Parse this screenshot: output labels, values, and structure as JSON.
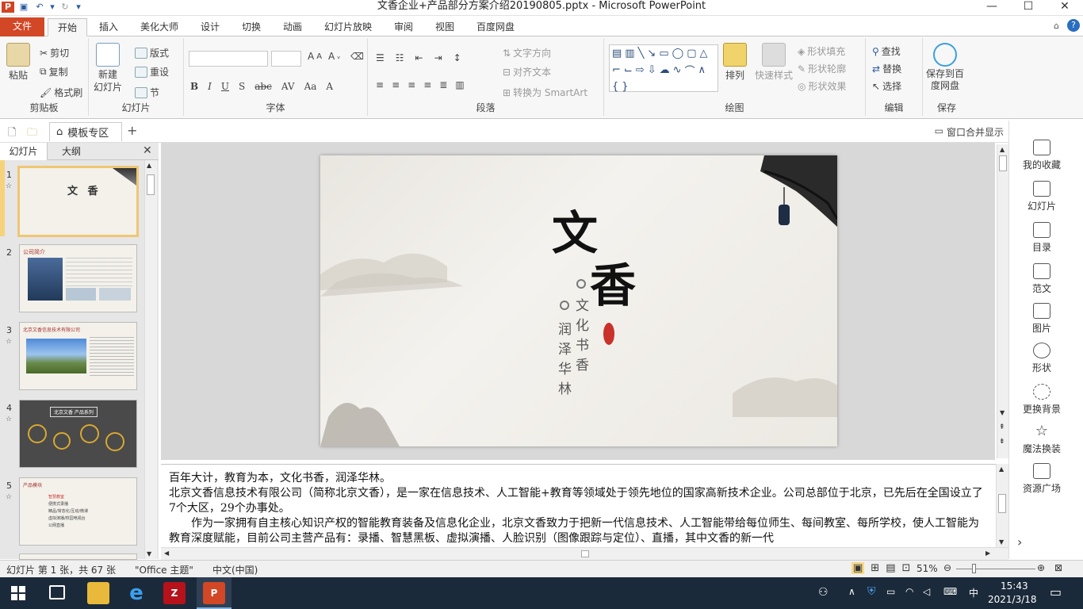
{
  "window": {
    "title": "文香企业+产品部分方案介绍20190805.pptx - Microsoft PowerPoint"
  },
  "ribbon_tabs": [
    "文件",
    "开始",
    "插入",
    "美化大师",
    "设计",
    "切换",
    "动画",
    "幻灯片放映",
    "审阅",
    "视图",
    "百度网盘"
  ],
  "ribbon": {
    "clipboard": {
      "paste": "粘贴",
      "cut": "剪切",
      "copy": "复制",
      "format_painter": "格式刷",
      "label": "剪贴板"
    },
    "slides": {
      "new_slide_1": "新建",
      "new_slide_2": "幻灯片",
      "layout": "版式",
      "reset": "重设",
      "section": "节",
      "label": "幻灯片"
    },
    "font": {
      "label": "字体"
    },
    "paragraph": {
      "text_direction": "文字方向",
      "align_text": "对齐文本",
      "smartart": "转换为 SmartArt",
      "label": "段落"
    },
    "drawing": {
      "arrange": "排列",
      "quick_styles": "快速样式",
      "shape_fill": "形状填充",
      "shape_outline": "形状轮廓",
      "shape_effects": "形状效果",
      "label": "绘图"
    },
    "editing": {
      "find": "查找",
      "replace": "替换",
      "select": "选择",
      "label": "编辑"
    },
    "save": {
      "baidu_1": "保存到百",
      "baidu_2": "度网盘",
      "label": "保存"
    }
  },
  "secondary_bar": {
    "template_tab": "模板专区",
    "merge_windows": "窗口合并显示"
  },
  "side_tabs": {
    "slides": "幻灯片",
    "outline": "大纲"
  },
  "thumbnails": [
    {
      "num": "1",
      "title": "文 香"
    },
    {
      "num": "2",
      "title": "公司简介"
    },
    {
      "num": "3",
      "title": "北京文香信息技术有限公司"
    },
    {
      "num": "4",
      "title": "北京文香 产品系列"
    },
    {
      "num": "5",
      "title": "产品模块"
    }
  ],
  "thumb5_items": [
    "智慧教室",
    "便携式录播",
    "精品/常态化/互动/微课",
    "虚拟演播/校园电视台",
    "公网直播"
  ],
  "slide": {
    "big_char_1": "文",
    "big_char_2": "香",
    "col_1": "文化书香",
    "col_2": "润泽华林"
  },
  "notes": {
    "line1": "百年大计，教育为本，文化书香，润泽华林。",
    "line2": "北京文香信息技术有限公司（简称北京文香），是一家在信息技术、人工智能+教育等领域处于领先地位的国家高新技术企业。公司总部位于北京，已先后在全国设立了7个大区，29个办事处。",
    "line3": "　　作为一家拥有自主核心知识产权的智能教育装备及信息化企业，北京文香致力于把新一代信息技术、人工智能带给每位师生、每间教室、每所学校，使人工智能为教育深度赋能，目前公司主营产品有：录播、智慧黑板、虚拟演播、人脸识别（图像跟踪与定位）、直播，其中文香的新一代"
  },
  "right_panel": [
    "我的收藏",
    "幻灯片",
    "目录",
    "范文",
    "图片",
    "形状",
    "更换背景",
    "魔法换装",
    "资源广场"
  ],
  "status": {
    "slide_info": "幻灯片 第 1 张，共 67 张",
    "theme": "\"Office 主题\"",
    "language": "中文(中国)",
    "zoom": "51%"
  },
  "taskbar": {
    "time": "15:43",
    "date": "2021/3/18",
    "ime": "中"
  }
}
